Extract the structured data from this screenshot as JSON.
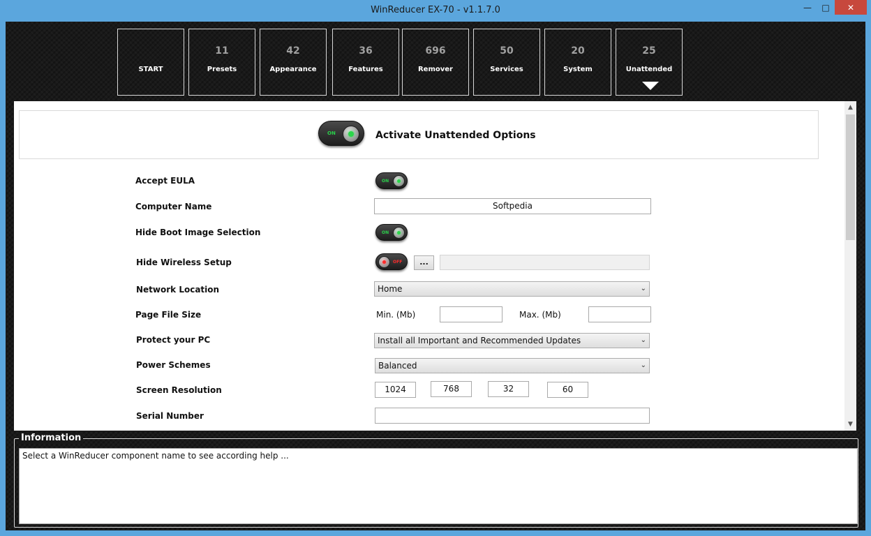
{
  "window": {
    "title": "WinReducer EX-70 - v1.1.7.0"
  },
  "tiles": [
    {
      "count": "",
      "label": "START"
    },
    {
      "count": "11",
      "label": "Presets"
    },
    {
      "count": "42",
      "label": "Appearance"
    },
    {
      "count": "36",
      "label": "Features"
    },
    {
      "count": "696",
      "label": "Remover"
    },
    {
      "count": "50",
      "label": "Services"
    },
    {
      "count": "20",
      "label": "System"
    },
    {
      "count": "25",
      "label": "Unattended"
    }
  ],
  "activate": {
    "label": "Activate Unattended Options",
    "state_text": "ON"
  },
  "toggles": {
    "on": "ON",
    "off": "OFF"
  },
  "form": {
    "accept_eula": {
      "label": "Accept EULA"
    },
    "computer_name": {
      "label": "Computer Name",
      "value": "Softpedia"
    },
    "hide_boot": {
      "label": "Hide Boot Image Selection"
    },
    "hide_wireless": {
      "label": "Hide Wireless Setup",
      "browse": "..."
    },
    "network_location": {
      "label": "Network Location",
      "value": "Home"
    },
    "page_file": {
      "label": "Page File Size",
      "min_label": "Min. (Mb)",
      "max_label": "Max. (Mb)",
      "min_value": "",
      "max_value": ""
    },
    "protect_pc": {
      "label": "Protect your PC",
      "value": "Install all Important and Recommended Updates"
    },
    "power": {
      "label": "Power Schemes",
      "value": "Balanced"
    },
    "screen": {
      "label": "Screen Resolution",
      "width": "1024",
      "height": "768",
      "depth": "32",
      "refresh": "60"
    },
    "serial": {
      "label": "Serial Number",
      "value": ""
    }
  },
  "information": {
    "title": "Information",
    "text": "Select a WinReducer component name to see according help ..."
  }
}
